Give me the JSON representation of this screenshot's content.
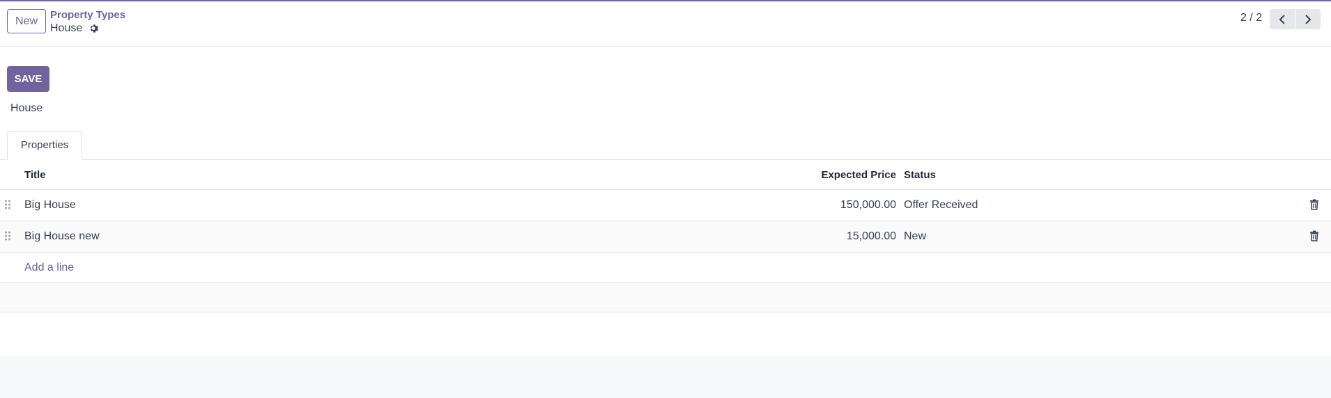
{
  "control_panel": {
    "new_label": "New",
    "breadcrumb_parent": "Property Types",
    "breadcrumb_current": "House",
    "pager_value": "2 / 2"
  },
  "form": {
    "save_label": "SAVE",
    "record_name": "House"
  },
  "tabs": [
    {
      "label": "Properties",
      "active": true
    }
  ],
  "table": {
    "columns": [
      "Title",
      "Expected Price",
      "Status"
    ],
    "rows": [
      {
        "title": "Big House",
        "expected_price": "150,000.00",
        "status": "Offer Received"
      },
      {
        "title": "Big House new",
        "expected_price": "15,000.00",
        "status": "New"
      }
    ],
    "add_line_label": "Add a line"
  },
  "colors": {
    "brand": "#71639e",
    "text": "#374151",
    "border": "#dee2e6"
  }
}
